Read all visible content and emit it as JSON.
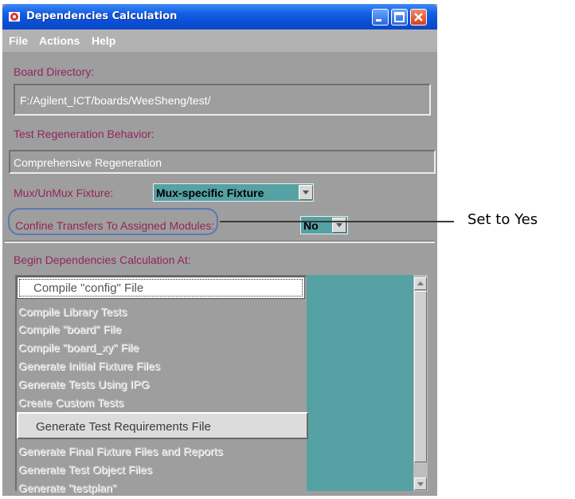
{
  "window": {
    "title": "Dependencies Calculation"
  },
  "menu": {
    "items": [
      "File",
      "Actions",
      "Help"
    ]
  },
  "board_directory": {
    "label": "Board Directory:",
    "value": "F:/Agilent_ICT/boards/WeeSheng/test/"
  },
  "test_regeneration": {
    "label": "Test Regeneration Behavior:",
    "value": "Comprehensive Regeneration"
  },
  "mux_fixture": {
    "label": "Mux/UnMux Fixture:",
    "selected": "Mux-specific Fixture"
  },
  "confine_transfers": {
    "label": "Confine Transfers To Assigned Modules:",
    "selected": "No"
  },
  "begin_calc": {
    "label": "Begin Dependencies Calculation At:",
    "items": [
      "Compile \"config\" File",
      "Compile Library Tests",
      "Compile \"board\" File",
      "Compile \"board_xy\" File",
      "Generate Initial Fixture Files",
      "Generate Tests Using IPG",
      "Create Custom Tests",
      "Generate Test Requirements File",
      "Generate Final Fixture Files and Reports",
      "Generate Test Object Files",
      "Generate \"testplan\""
    ]
  },
  "callout": {
    "text": "Set to Yes"
  },
  "colors": {
    "label": "#93255a",
    "panel": "#9e9e9e",
    "teal": "#55a1a4",
    "titlebar": "#1560e6"
  },
  "icons": {
    "app": "app-icon",
    "minimize": "minimize-icon",
    "maximize": "maximize-icon",
    "close": "close-icon"
  }
}
